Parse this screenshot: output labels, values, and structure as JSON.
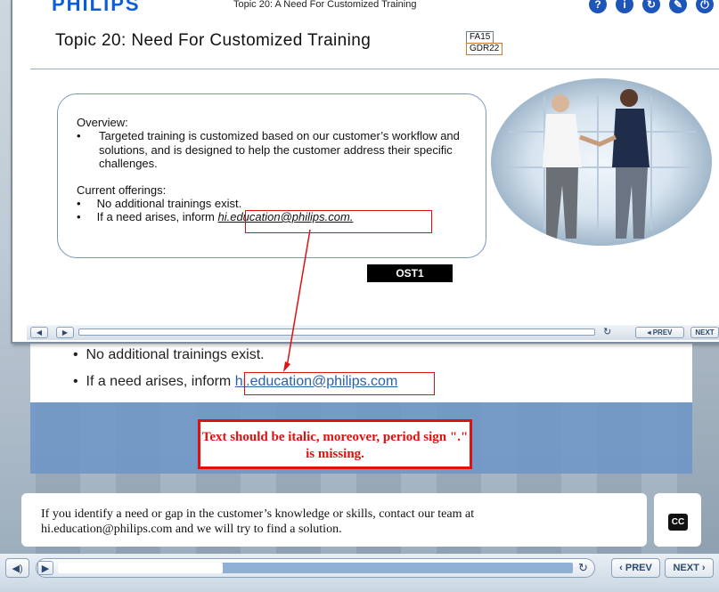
{
  "header": {
    "logo": "PHILIPS",
    "small_title": "Topic 20: A Need For Customized Training",
    "icons": [
      "help-icon",
      "info-icon",
      "refresh-icon",
      "edit-icon",
      "power-icon"
    ],
    "icon_glyphs": [
      "?",
      "i",
      "↻",
      "✎",
      "⏻"
    ]
  },
  "slide": {
    "title": "Topic 20: Need For Customized Training",
    "tag1": "FA15",
    "tag2": "GDR22",
    "overview_heading": "Overview:",
    "overview_bullet": "Targeted training is customized based on our customer’s workflow and solutions, and is designed to help the customer address their specific challenges.",
    "offerings_heading": "Current offerings:",
    "offering1": "No additional trainings exist.",
    "offering2_prefix": "If a need arises, inform",
    "offering2_email": "hi.education@philips.com.",
    "ost_label": "OST1",
    "prev": "◂ PREV",
    "next": "NEXT"
  },
  "course": {
    "bullet1": "No additional trainings exist.",
    "bullet2_prefix": "If a need arises, inform",
    "bullet2_email": "hi.education@philips.com",
    "annotation": "Text should be italic, moreover, period sign \".\" is missing.",
    "caption_line1": "If you identify a need or gap in the customer’s knowledge or skills, contact our team at",
    "caption_line2": "hi.education@philips.com and we will try to find a solution.",
    "cc_label": "CC"
  },
  "player": {
    "progress": 0.32,
    "prev_label": "PREV",
    "next_label": "NEXT"
  },
  "colors": {
    "accent": "#0b5ed7",
    "error": "#dd1111"
  }
}
